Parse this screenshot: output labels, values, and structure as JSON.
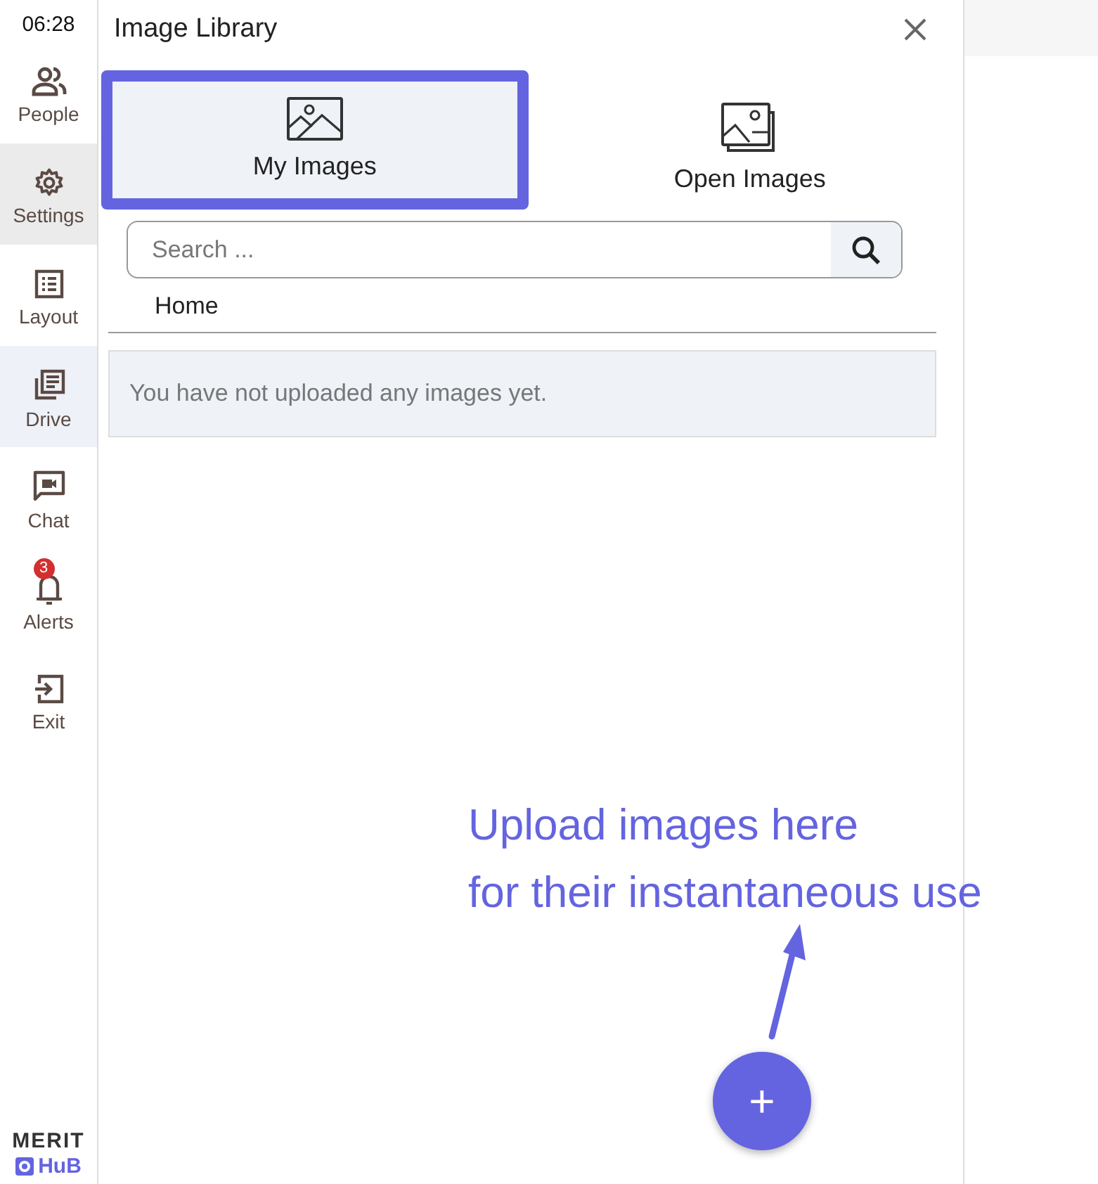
{
  "clock": "06:28",
  "sidebar": {
    "items": [
      {
        "label": "People",
        "kind": "people",
        "selected": false,
        "hovered": false
      },
      {
        "label": "Settings",
        "kind": "settings",
        "selected": true,
        "hovered": false
      },
      {
        "label": "Layout",
        "kind": "layout",
        "selected": false,
        "hovered": false
      },
      {
        "label": "Drive",
        "kind": "drive",
        "selected": false,
        "hovered": true
      },
      {
        "label": "Chat",
        "kind": "chat",
        "selected": false,
        "hovered": false
      },
      {
        "label": "Alerts",
        "kind": "alerts",
        "selected": false,
        "hovered": false,
        "badge": "3"
      },
      {
        "label": "Exit",
        "kind": "exit",
        "selected": false,
        "hovered": false
      }
    ]
  },
  "logo": {
    "top": "MERIT",
    "bottom": "HuB"
  },
  "window": {
    "title": "Image Library"
  },
  "tabs": [
    {
      "label": "My Images",
      "kind": "mine",
      "selected": true
    },
    {
      "label": "Open Images",
      "kind": "open",
      "selected": false
    }
  ],
  "search": {
    "placeholder": "Search ..."
  },
  "breadcrumb": "Home",
  "empty_message": "You have not uploaded any images yet.",
  "annotation": {
    "lines": [
      "Upload images here",
      "for their instantaneous use"
    ]
  },
  "fab": {
    "label": "+"
  }
}
